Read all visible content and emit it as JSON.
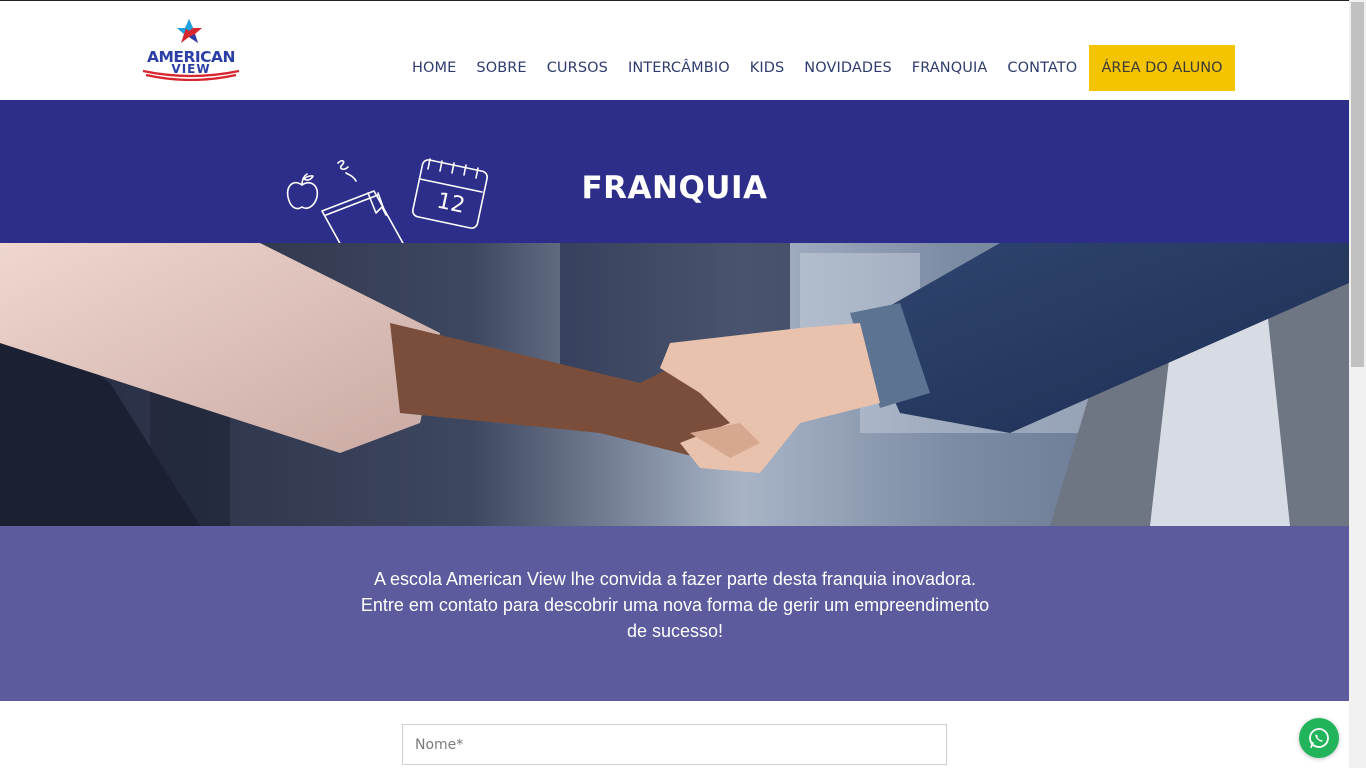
{
  "brand": {
    "logo_line1": "AMERICAN",
    "logo_line2": "VIEW",
    "colors": {
      "blue": "#2b3fa6",
      "red": "#d8262e",
      "star": "#1aa3e0"
    }
  },
  "nav": {
    "items": [
      {
        "label": "HOME"
      },
      {
        "label": "SOBRE"
      },
      {
        "label": "CURSOS"
      },
      {
        "label": "INTERCÂMBIO"
      },
      {
        "label": "KIDS"
      },
      {
        "label": "NOVIDADES"
      },
      {
        "label": "FRANQUIA"
      },
      {
        "label": "CONTATO"
      }
    ],
    "cta_label": "ÁREA DO ALUNO",
    "cta_color": "#f5c400"
  },
  "banner": {
    "title": "FRANQUIA",
    "background": "#2d2e8a",
    "doodle_calendar_number": "12"
  },
  "hero": {
    "image_subject": "handshake-photo"
  },
  "intro": {
    "text": "A escola American View lhe convida a fazer parte desta franquia inovadora. Entre em contato para descobrir uma nova forma de gerir um empreendimento de sucesso!",
    "background": "#5b5b9e"
  },
  "form": {
    "name_placeholder": "Nome*"
  },
  "floating": {
    "whatsapp_icon": "whatsapp-icon",
    "color": "#22b45a"
  }
}
